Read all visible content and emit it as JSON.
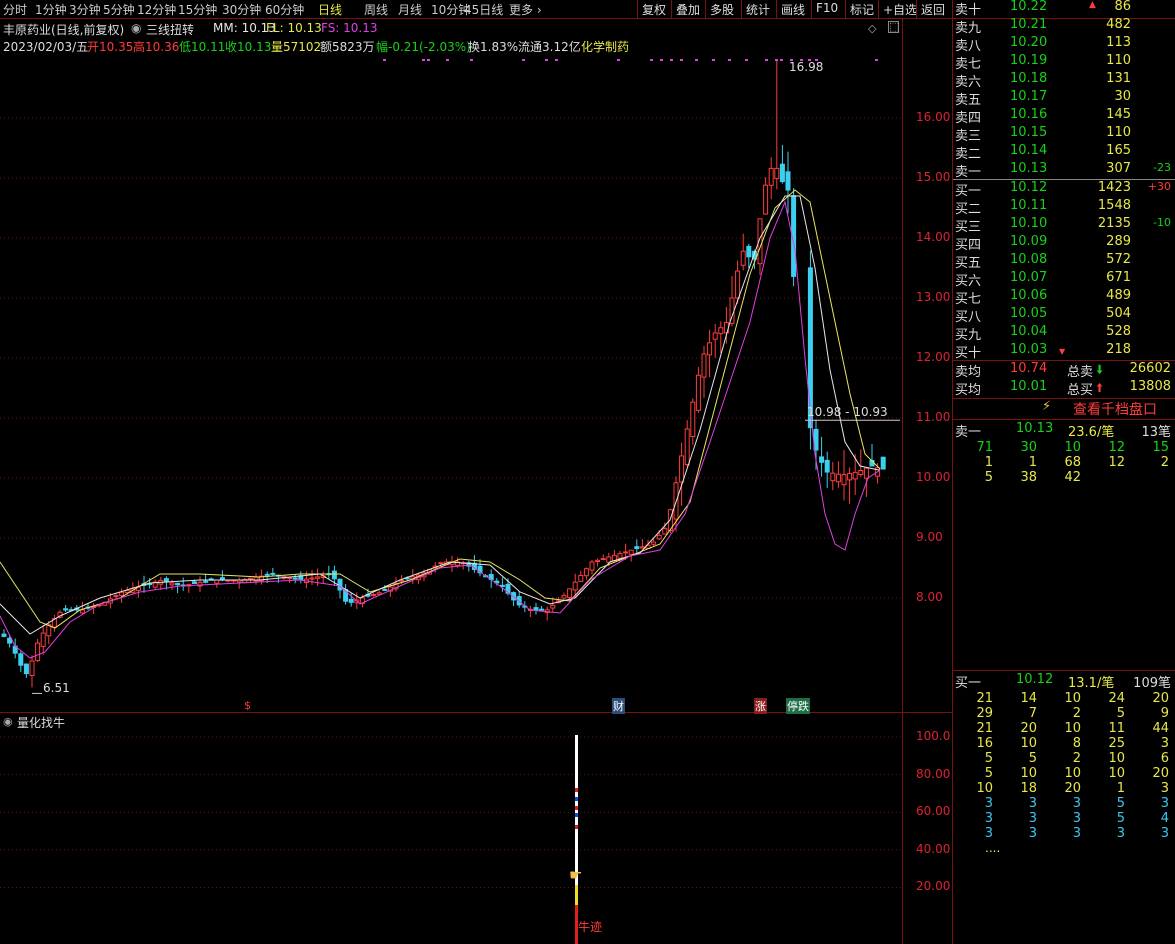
{
  "toolbar": {
    "periods": [
      "分时",
      "1分钟",
      "3分钟",
      "5分钟",
      "12分钟",
      "15分钟",
      "30分钟",
      "60分钟",
      "日线",
      "周线",
      "月线",
      "10分钟",
      "45日线",
      "更多 ›"
    ],
    "tools": [
      "复权",
      "叠加",
      "多股",
      "统计",
      "画线",
      "F10",
      "标记",
      "+自选",
      "返回"
    ]
  },
  "header": {
    "stock": "丰原药业(日线,前复权)",
    "indicator": "三线扭转",
    "mm": "MM: 10.13",
    "fl": "FL: 10.13",
    "fs": "FS: 10.13",
    "date": "2023/02/03/五",
    "open": "开10.35",
    "high": "高10.36",
    "low": "低10.11",
    "close": "收10.13",
    "volume": "量57102",
    "amount": "额5823万",
    "range": "幅-0.21(-2.03%)",
    "turnover": "换1.83%",
    "float": "流通3.12亿",
    "sector": "化学制药"
  },
  "chart": {
    "price_labels": [
      "16.00",
      "15.00",
      "14.00",
      "13.00",
      "12.00",
      "11.00",
      "10.00",
      "9.00",
      "8.00"
    ],
    "max_label": "16.98",
    "min_label": "6.51",
    "range_label": "10.98 - 10.93",
    "event_marks": [
      "$",
      "财",
      "涨",
      "停跌"
    ],
    "sub_title": "量化找牛",
    "sub_labels": [
      "100.0",
      "80.00",
      "60.00",
      "40.00",
      "20.00"
    ],
    "sub_tag": "牛迹"
  },
  "order_book": {
    "sells": [
      {
        "label": "卖十",
        "price": "10.22",
        "vol": "86",
        "chg": ""
      },
      {
        "label": "卖九",
        "price": "10.21",
        "vol": "482",
        "chg": ""
      },
      {
        "label": "卖八",
        "price": "10.20",
        "vol": "113",
        "chg": ""
      },
      {
        "label": "卖七",
        "price": "10.19",
        "vol": "110",
        "chg": ""
      },
      {
        "label": "卖六",
        "price": "10.18",
        "vol": "131",
        "chg": ""
      },
      {
        "label": "卖五",
        "price": "10.17",
        "vol": "30",
        "chg": ""
      },
      {
        "label": "卖四",
        "price": "10.16",
        "vol": "145",
        "chg": ""
      },
      {
        "label": "卖三",
        "price": "10.15",
        "vol": "110",
        "chg": ""
      },
      {
        "label": "卖二",
        "price": "10.14",
        "vol": "165",
        "chg": ""
      },
      {
        "label": "卖一",
        "price": "10.13",
        "vol": "307",
        "chg": "-23"
      }
    ],
    "buys": [
      {
        "label": "买一",
        "price": "10.12",
        "vol": "1423",
        "chg": "+30"
      },
      {
        "label": "买二",
        "price": "10.11",
        "vol": "1548",
        "chg": ""
      },
      {
        "label": "买三",
        "price": "10.10",
        "vol": "2135",
        "chg": "-10"
      },
      {
        "label": "买四",
        "price": "10.09",
        "vol": "289",
        "chg": ""
      },
      {
        "label": "买五",
        "price": "10.08",
        "vol": "572",
        "chg": ""
      },
      {
        "label": "买六",
        "price": "10.07",
        "vol": "671",
        "chg": ""
      },
      {
        "label": "买七",
        "price": "10.06",
        "vol": "489",
        "chg": ""
      },
      {
        "label": "买八",
        "price": "10.05",
        "vol": "504",
        "chg": ""
      },
      {
        "label": "买九",
        "price": "10.04",
        "vol": "528",
        "chg": ""
      },
      {
        "label": "买十",
        "price": "10.03",
        "vol": "218",
        "chg": ""
      }
    ],
    "avg_sell_label": "卖均",
    "avg_sell": "10.74",
    "total_sell_label": "总卖",
    "total_sell": "26602",
    "avg_buy_label": "买均",
    "avg_buy": "10.01",
    "total_buy_label": "总买",
    "total_buy": "13808",
    "thousand_btn": "查看千档盘口",
    "sell1": {
      "label": "卖一",
      "price": "10.13",
      "per": "23.6/笔",
      "count": "13笔"
    },
    "sell1_ticks": [
      [
        "71",
        "30",
        "10",
        "12",
        "15"
      ],
      [
        "1",
        "1",
        "68",
        "12",
        "2"
      ],
      [
        "5",
        "38",
        "42",
        "",
        ""
      ]
    ],
    "buy1": {
      "label": "买一",
      "price": "10.12",
      "per": "13.1/笔",
      "count": "109笔"
    },
    "buy1_ticks": [
      [
        "21",
        "14",
        "10",
        "24",
        "20"
      ],
      [
        "29",
        "7",
        "2",
        "5",
        "9"
      ],
      [
        "21",
        "20",
        "10",
        "11",
        "44"
      ],
      [
        "16",
        "10",
        "8",
        "25",
        "3"
      ],
      [
        "5",
        "5",
        "2",
        "10",
        "6"
      ],
      [
        "5",
        "10",
        "10",
        "10",
        "20"
      ],
      [
        "10",
        "18",
        "20",
        "1",
        "3"
      ],
      [
        "3",
        "3",
        "3",
        "5",
        "3"
      ],
      [
        "3",
        "3",
        "3",
        "5",
        "4"
      ],
      [
        "3",
        "3",
        "3",
        "3",
        "3"
      ]
    ],
    "more": "...."
  },
  "colors": {
    "up": "#ff3c3c",
    "down": "#3cd0f0",
    "border": "#7a1111",
    "ma_yellow": "#e8e860",
    "ma_white": "#e6e6e6",
    "ma_magenta": "#e040e0"
  }
}
